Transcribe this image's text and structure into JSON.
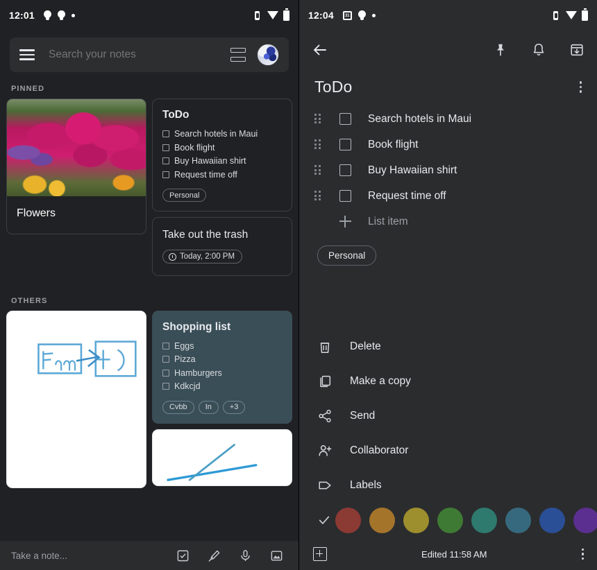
{
  "left": {
    "status_bar": {
      "time": "12:01",
      "icons": [
        "bulb-icon",
        "bulb-icon",
        "dot-icon"
      ],
      "right_icons": [
        "vibrate-icon",
        "wifi-icon",
        "battery-icon"
      ]
    },
    "search": {
      "menu_icon": "hamburger-icon",
      "placeholder": "Search your notes",
      "view_toggle_icon": "list-view-icon",
      "avatar": "account-avatar"
    },
    "sections": {
      "pinned_label": "PINNED",
      "others_label": "OTHERS"
    },
    "pinned": {
      "photo_note": {
        "title": "Flowers"
      },
      "todo_note": {
        "title": "ToDo",
        "items": [
          "Search hotels in Maui",
          "Book flight",
          "Buy Hawaiian shirt",
          "Request time off"
        ],
        "labels": [
          "Personal"
        ]
      },
      "reminder_note": {
        "title": "Take out the trash",
        "reminder": "Today, 2:00 PM",
        "reminder_icon": "clock-icon"
      }
    },
    "others": {
      "drawing_note_1": {
        "sketch_text": "Fcm"
      },
      "shopping_note": {
        "title": "Shopping list",
        "items": [
          "Eggs",
          "Pizza",
          "Hamburgers",
          "Kdkcjd"
        ],
        "labels": [
          "Cvbb",
          "In",
          "+3"
        ]
      },
      "drawing_note_2": {
        "sketch_text": ""
      }
    },
    "bottom_bar": {
      "placeholder": "Take a note...",
      "actions": [
        "new-list-icon",
        "new-drawing-icon",
        "new-voice-note-icon",
        "new-image-note-icon"
      ]
    }
  },
  "right": {
    "status_bar": {
      "time": "12:04",
      "icons": [
        "calendar-icon",
        "bulb-icon",
        "dot-icon"
      ],
      "right_icons": [
        "vibrate-icon",
        "wifi-icon",
        "battery-icon"
      ]
    },
    "toolbar": {
      "back_icon": "back-arrow-icon",
      "pin_icon": "pin-icon",
      "reminder_icon": "bell-icon",
      "archive_icon": "archive-icon"
    },
    "note": {
      "title": "ToDo",
      "overflow_icon": "kebab-menu-icon",
      "items": [
        {
          "text": "Search hotels in Maui",
          "checked": false
        },
        {
          "text": "Book flight",
          "checked": false
        },
        {
          "text": "Buy Hawaiian shirt",
          "checked": false
        },
        {
          "text": "Request time off",
          "checked": false
        }
      ],
      "add_item_label": "List item",
      "labels": [
        "Personal"
      ]
    },
    "menu": [
      {
        "label": "Delete",
        "icon": "trash-icon"
      },
      {
        "label": "Make a copy",
        "icon": "copy-icon"
      },
      {
        "label": "Send",
        "icon": "share-icon"
      },
      {
        "label": "Collaborator",
        "icon": "person-add-icon"
      },
      {
        "label": "Labels",
        "icon": "label-tag-icon"
      }
    ],
    "colors": {
      "selected_index": 0,
      "check_icon": "check-icon",
      "swatches": [
        "#8c3a34",
        "#a5742b",
        "#9e8f2e",
        "#3f7a35",
        "#2e7a6e",
        "#36697e",
        "#2b4f96",
        "#5b2f8f"
      ]
    },
    "footer": {
      "add_icon": "add-box-icon",
      "edited_text": "Edited 11:58 AM",
      "overflow_icon": "kebab-menu-icon"
    }
  }
}
